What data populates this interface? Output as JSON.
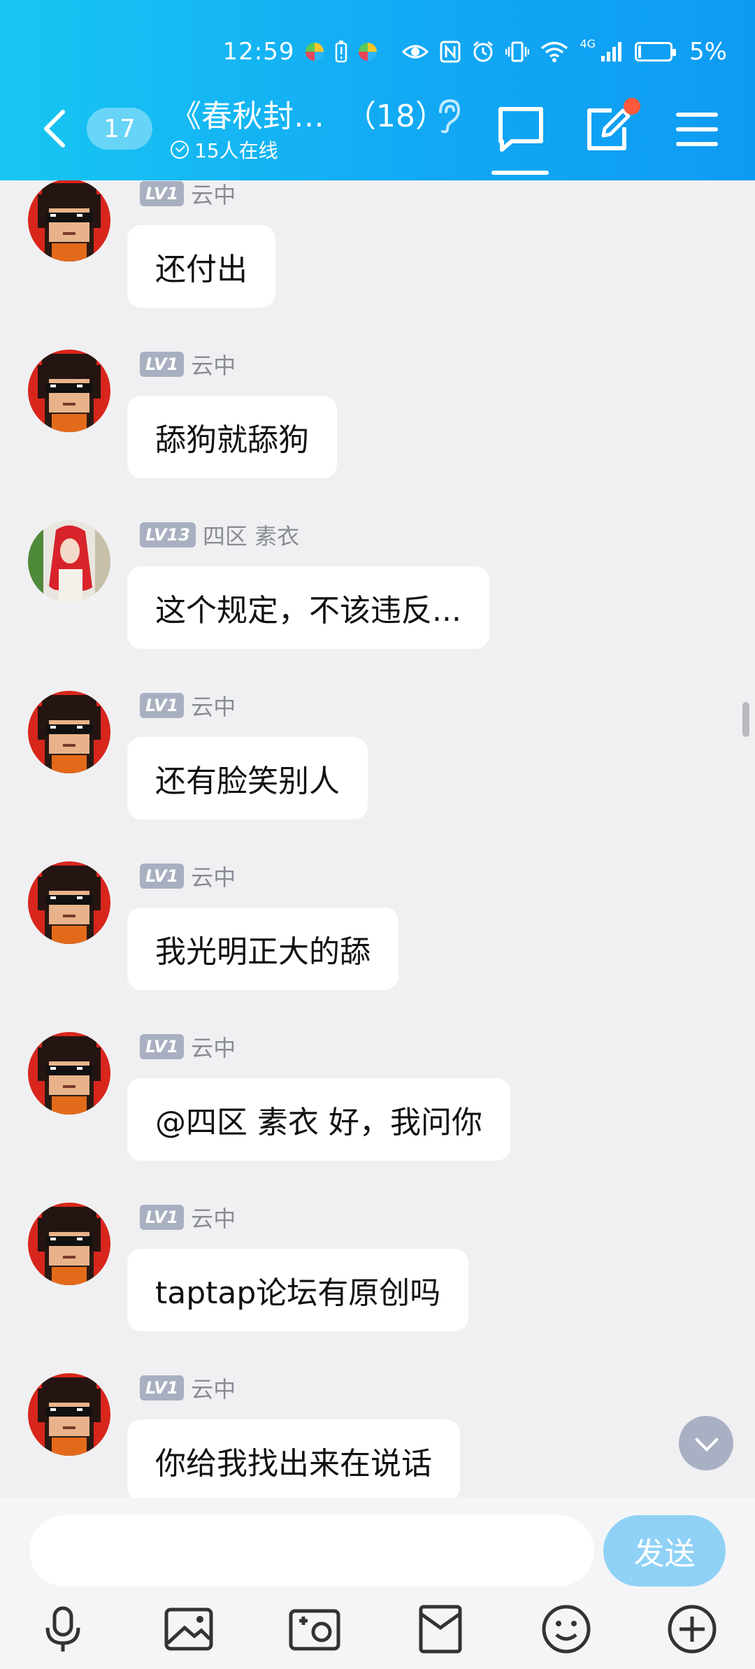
{
  "status_bar": {
    "time": "12:59",
    "battery": "5%",
    "network": "4G"
  },
  "header": {
    "unread_count": "17",
    "title": "《春秋封…",
    "member_count": "（18）",
    "online_text": "15人在线"
  },
  "messages": [
    {
      "level": "LV1",
      "name": "云中",
      "text": "还付出",
      "avatar": "pixel-sunglasses"
    },
    {
      "level": "LV1",
      "name": "云中",
      "text": "舔狗就舔狗",
      "avatar": "pixel-sunglasses"
    },
    {
      "level": "LV13",
      "name": "四区 素衣",
      "text": "这个规定，不该违反...",
      "avatar": "red-hair"
    },
    {
      "level": "LV1",
      "name": "云中",
      "text": "还有脸笑别人",
      "avatar": "pixel-sunglasses"
    },
    {
      "level": "LV1",
      "name": "云中",
      "text": "我光明正大的舔",
      "avatar": "pixel-sunglasses"
    },
    {
      "level": "LV1",
      "name": "云中",
      "text": "@四区 素衣 好，我问你",
      "avatar": "pixel-sunglasses"
    },
    {
      "level": "LV1",
      "name": "云中",
      "text": "taptap论坛有原创吗",
      "avatar": "pixel-sunglasses"
    },
    {
      "level": "LV1",
      "name": "云中",
      "text": "你给我找出来在说话",
      "avatar": "pixel-sunglasses"
    }
  ],
  "input": {
    "placeholder": "",
    "send_label": "发送"
  },
  "toolbar": {
    "icons": [
      "microphone-icon",
      "image-icon",
      "camera-icon",
      "red-packet-icon",
      "emoji-icon",
      "plus-icon"
    ]
  },
  "colors": {
    "header_start": "#18c6f2",
    "header_end": "#0d9bf2",
    "send_button": "#8fd2f6",
    "level_badge": "#a8afc0",
    "notification_dot": "#ff5a3c"
  }
}
